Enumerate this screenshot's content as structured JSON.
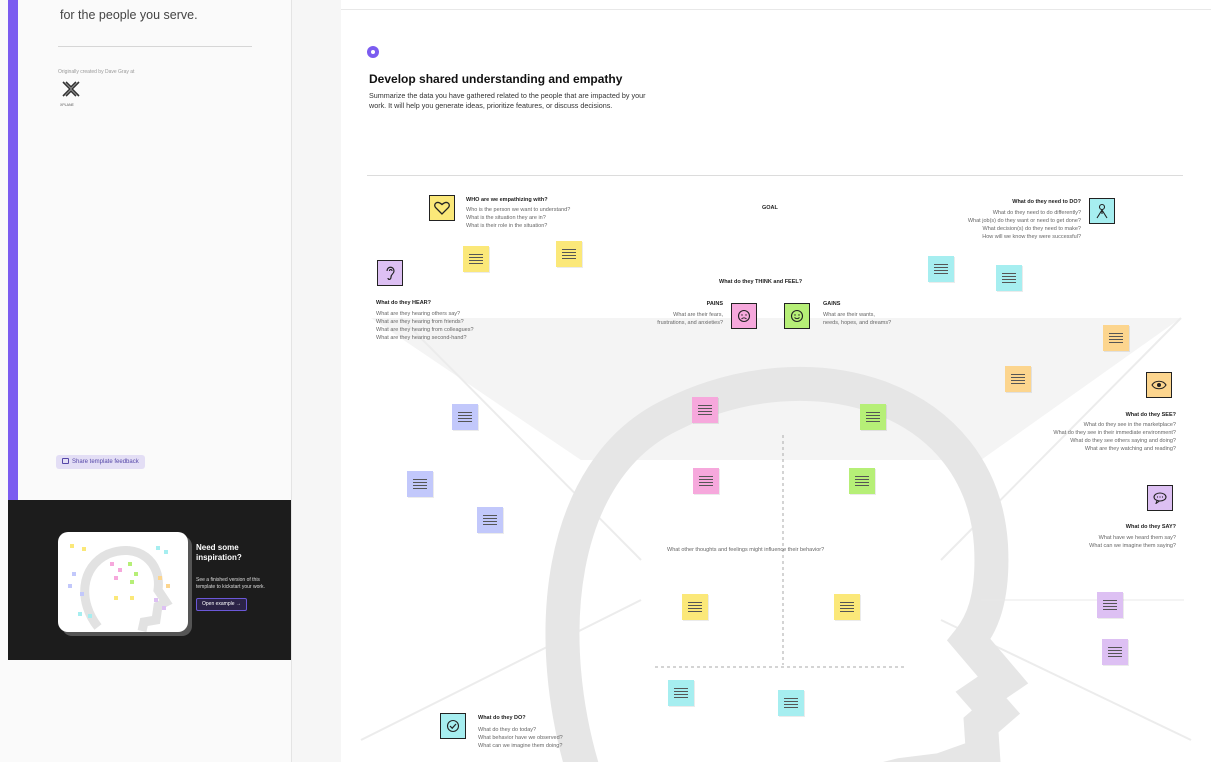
{
  "sidebar": {
    "intro_text": "for the people you serve.",
    "credit": "Originally created by Dave Gray at",
    "logo_label": "XPLANE",
    "feedback_label": "Share template feedback",
    "promo": {
      "title": "Need some inspiration?",
      "description": "See a finished version of this template to kickstart your work.",
      "button_label": "Open example"
    }
  },
  "step": {
    "title": "Develop shared understanding and empathy",
    "description": "Summarize the data you have gathered related to the people that are impacted by your work. It will help you generate ideas, prioritize features, or discuss decisions."
  },
  "map": {
    "who": {
      "title": "WHO are we empathizing with?",
      "questions": [
        "Who is the person we want to understand?",
        "What is the situation they are in?",
        "What is their role in the situation?"
      ]
    },
    "goal": "GOAL",
    "need_to_do": {
      "title": "What do they need to DO?",
      "questions": [
        "What do they need to do differently?",
        "What job(s) do they want or need to get done?",
        "What decision(s) do they need to make?",
        "How will we know they were successful?"
      ]
    },
    "hear": {
      "title": "What do they HEAR?",
      "questions": [
        "What are they hearing others say?",
        "What are they hearing from friends?",
        "What are they hearing from colleagues?",
        "What are they hearing second-hand?"
      ]
    },
    "think_feel": "What do they THINK and FEEL?",
    "pains": {
      "title": "PAINS",
      "questions": [
        "What are their fears,",
        "frustrations, and anxieties?"
      ]
    },
    "gains": {
      "title": "GAINS",
      "questions": [
        "What are their wants,",
        "needs, hopes, and dreams?"
      ]
    },
    "see": {
      "title": "What do they SEE?",
      "questions": [
        "What do they see in the marketplace?",
        "What do they see in their immediate environment?",
        "What do they see others saying and doing?",
        "What are they watching and reading?"
      ]
    },
    "say": {
      "title": "What do they SAY?",
      "questions": [
        "What have we heard them say?",
        "What can we imagine them saying?"
      ]
    },
    "influence": "What other thoughts and feelings might influence their behavior?",
    "do": {
      "title": "What do they DO?",
      "questions": [
        "What do they do today?",
        "What behavior have we observed?",
        "What can we imagine them doing?"
      ]
    }
  },
  "colors": {
    "accent": "#7b5cf0",
    "yellow": "#fbe879",
    "cyan": "#a6eef0",
    "pink": "#f6a8dc",
    "green": "#b6ef77",
    "orange": "#fcd58e",
    "blue": "#c2c8fb",
    "purple": "#ddc0f3"
  },
  "icons": [
    "heart-icon",
    "person-icon",
    "ear-icon",
    "frown-icon",
    "smile-icon",
    "eye-icon",
    "speech-bubble-icon",
    "check-icon",
    "xplane-logo-icon",
    "arrow-right-icon",
    "chat-icon"
  ]
}
